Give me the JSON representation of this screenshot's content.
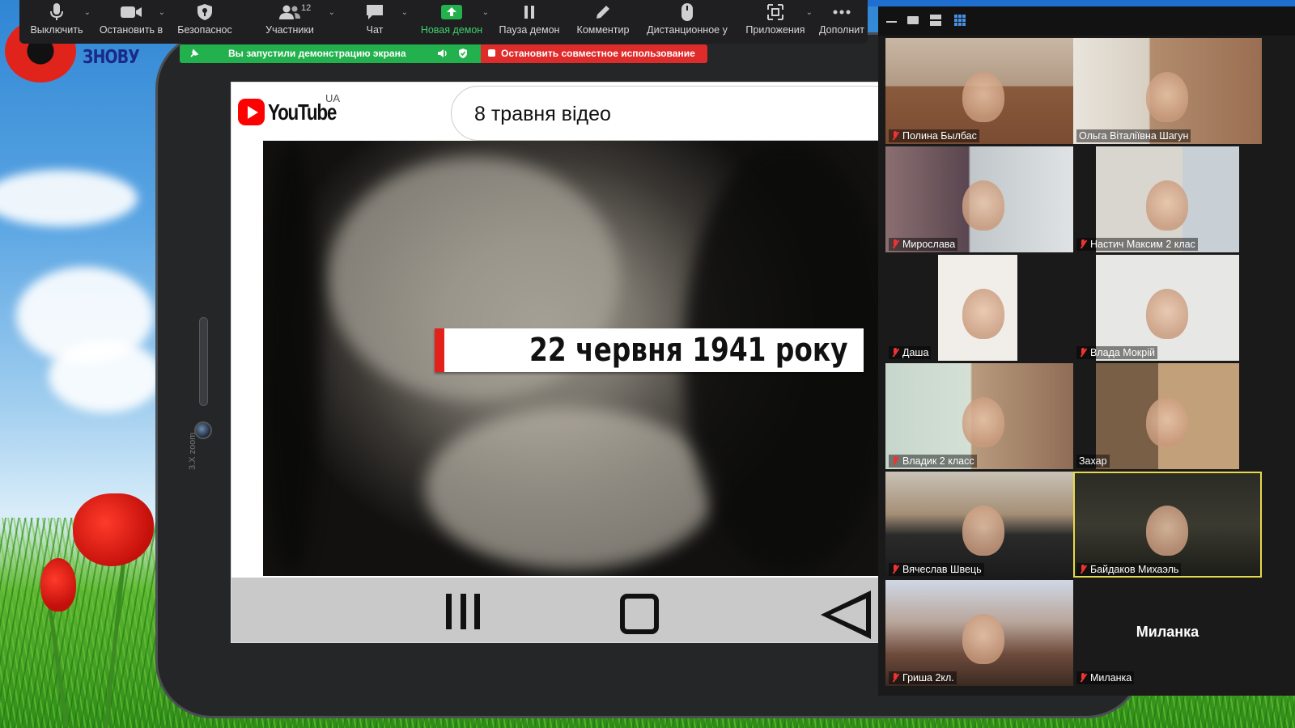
{
  "toolbar": {
    "items": [
      {
        "label": "Выключить",
        "icon": "microphone-icon",
        "has_caret": true
      },
      {
        "label": "Остановить в",
        "icon": "video-camera-icon",
        "has_caret": true
      },
      {
        "label": "Безопаснос",
        "icon": "shield-icon",
        "has_caret": false
      },
      {
        "label": "Участники",
        "icon": "participants-icon",
        "has_caret": true,
        "count": "12"
      },
      {
        "label": "Чат",
        "icon": "chat-icon",
        "has_caret": true
      },
      {
        "label": "Новая демон",
        "icon": "share-screen-icon",
        "has_caret": true,
        "active": true
      },
      {
        "label": "Пауза демон",
        "icon": "pause-icon",
        "has_caret": false
      },
      {
        "label": "Комментир",
        "icon": "pencil-icon",
        "has_caret": false
      },
      {
        "label": "Дистанционное у",
        "icon": "mouse-icon",
        "has_caret": false
      },
      {
        "label": "Приложения",
        "icon": "apps-icon",
        "has_caret": true
      },
      {
        "label": "Дополнит",
        "icon": "more-icon",
        "has_caret": false
      }
    ],
    "accent": "#3fd06a"
  },
  "share_bar": {
    "status": "Вы запустили демонстрацию экрана",
    "stop": "Остановить совместное использование",
    "status_color": "#22b14c",
    "stop_color": "#e02b2b"
  },
  "wallpaper": {
    "logo_text": "ЗНОВУ"
  },
  "tablet": {
    "camera_label": "3.X zoom"
  },
  "youtube": {
    "logo": "YouTube",
    "country": "UA",
    "search_value": "8 травня відео"
  },
  "video": {
    "caption": "22 червня 1941 року"
  },
  "gallery": {
    "participants": [
      {
        "name": "Полина Былбас",
        "muted": true
      },
      {
        "name": "Ольга Віталіївна Шагун",
        "muted": false
      },
      {
        "name": "Мирослава",
        "muted": true
      },
      {
        "name": "Настич Максим 2 клас",
        "muted": true
      },
      {
        "name": "Даша",
        "muted": true
      },
      {
        "name": "Влада Мокрій",
        "muted": true
      },
      {
        "name": "Владик 2 класс",
        "muted": true
      },
      {
        "name": "Захар",
        "muted": false
      },
      {
        "name": "Вячеслав Швець",
        "muted": true
      },
      {
        "name": "Байдаков Михаэль",
        "muted": true,
        "active_speaker": true
      },
      {
        "name": "Гриша 2кл.",
        "muted": true
      },
      {
        "name": "Миланка",
        "muted": true,
        "video_off": true
      }
    ],
    "active_color": "#e8d94a"
  }
}
